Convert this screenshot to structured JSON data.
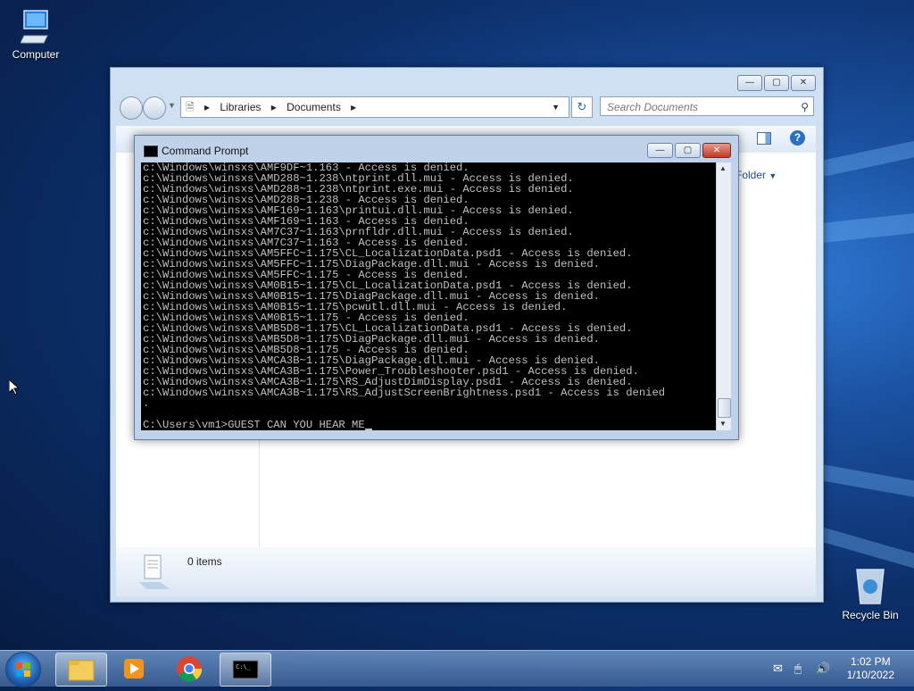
{
  "desktop": {
    "computer_label": "Computer",
    "recycle_label": "Recycle Bin"
  },
  "explorer": {
    "breadcrumb": [
      "Libraries",
      "Documents"
    ],
    "search_placeholder": "Search Documents",
    "folder_button": "Folder",
    "items_count": "0 items"
  },
  "cmd": {
    "title": "Command Prompt",
    "lines": [
      "c:\\Windows\\winsxs\\AMF9DF~1.163 - Access is denied.",
      "c:\\Windows\\winsxs\\AMD288~1.238\\ntprint.dll.mui - Access is denied.",
      "c:\\Windows\\winsxs\\AMD288~1.238\\ntprint.exe.mui - Access is denied.",
      "c:\\Windows\\winsxs\\AMD288~1.238 - Access is denied.",
      "c:\\Windows\\winsxs\\AMF169~1.163\\printui.dll.mui - Access is denied.",
      "c:\\Windows\\winsxs\\AMF169~1.163 - Access is denied.",
      "c:\\Windows\\winsxs\\AM7C37~1.163\\prnfldr.dll.mui - Access is denied.",
      "c:\\Windows\\winsxs\\AM7C37~1.163 - Access is denied.",
      "c:\\Windows\\winsxs\\AM5FFC~1.175\\CL_LocalizationData.psd1 - Access is denied.",
      "c:\\Windows\\winsxs\\AM5FFC~1.175\\DiagPackage.dll.mui - Access is denied.",
      "c:\\Windows\\winsxs\\AM5FFC~1.175 - Access is denied.",
      "c:\\Windows\\winsxs\\AM0B15~1.175\\CL_LocalizationData.psd1 - Access is denied.",
      "c:\\Windows\\winsxs\\AM0B15~1.175\\DiagPackage.dll.mui - Access is denied.",
      "c:\\Windows\\winsxs\\AM0B15~1.175\\pcwutl.dll.mui - Access is denied.",
      "c:\\Windows\\winsxs\\AM0B15~1.175 - Access is denied.",
      "c:\\Windows\\winsxs\\AMB5D8~1.175\\CL_LocalizationData.psd1 - Access is denied.",
      "c:\\Windows\\winsxs\\AMB5D8~1.175\\DiagPackage.dll.mui - Access is denied.",
      "c:\\Windows\\winsxs\\AMB5D8~1.175 - Access is denied.",
      "c:\\Windows\\winsxs\\AMCA3B~1.175\\DiagPackage.dll.mui - Access is denied.",
      "c:\\Windows\\winsxs\\AMCA3B~1.175\\Power_Troubleshooter.psd1 - Access is denied.",
      "c:\\Windows\\winsxs\\AMCA3B~1.175\\RS_AdjustDimDisplay.psd1 - Access is denied.",
      "c:\\Windows\\winsxs\\AMCA3B~1.175\\RS_AdjustScreenBrightness.psd1 - Access is denied",
      ".",
      "",
      "C:\\Users\\vm1>GUEST CAN YOU HEAR ME"
    ]
  },
  "clock": {
    "time": "1:02 PM",
    "date": "1/10/2022"
  }
}
